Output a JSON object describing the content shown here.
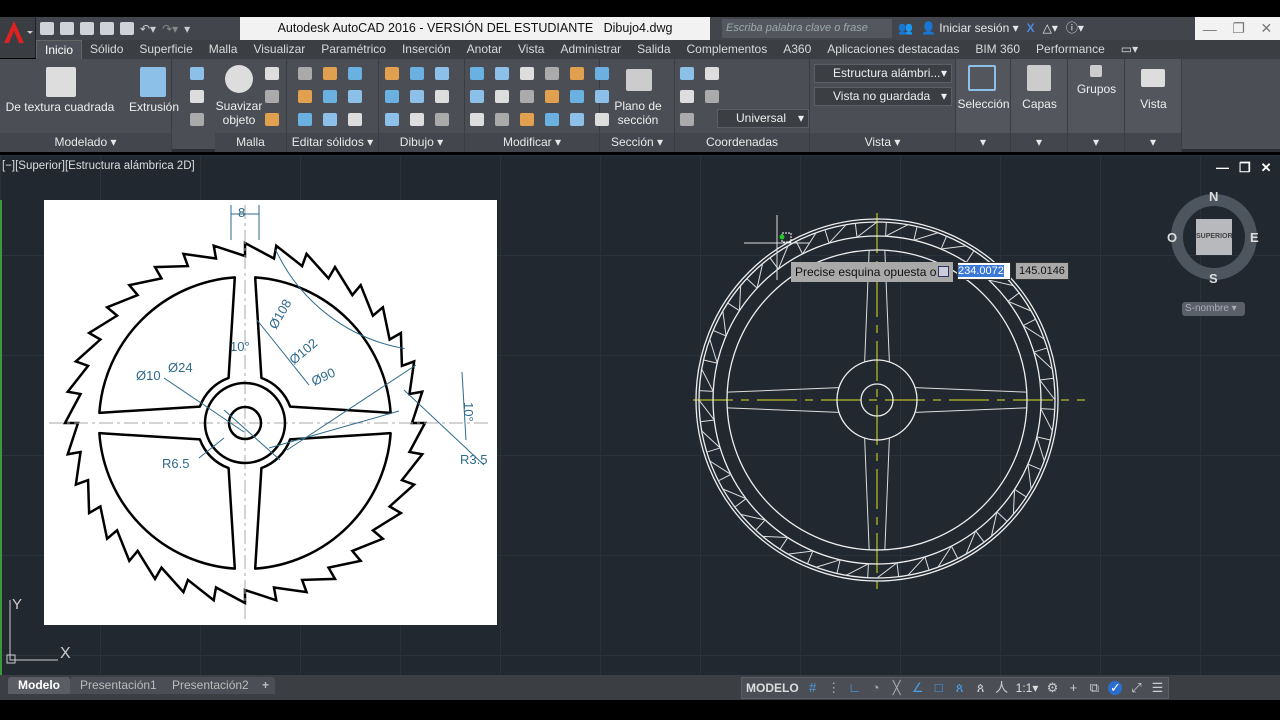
{
  "title": {
    "app": "Autodesk AutoCAD 2016 - VERSIÓN DEL ESTUDIANTE",
    "file": "Dibujo4.dwg"
  },
  "search": {
    "placeholder": "Escriba palabra clave o frase"
  },
  "signin": "Iniciar sesión",
  "tabs": [
    "Inicio",
    "Sólido",
    "Superficie",
    "Malla",
    "Visualizar",
    "Paramétrico",
    "Inserción",
    "Anotar",
    "Vista",
    "Administrar",
    "Salida",
    "Complementos",
    "A360",
    "Aplicaciones destacadas",
    "BIM 360",
    "Performance"
  ],
  "ribbon": {
    "modelado": {
      "label": "Modelado",
      "box": "De textura cuadrada",
      "extrude": "Extrusión"
    },
    "malla": {
      "label": "Malla",
      "smooth": "Suavizar objeto"
    },
    "editar": {
      "label": "Editar sólidos"
    },
    "dibujo": {
      "label": "Dibujo"
    },
    "modificar": {
      "label": "Modificar"
    },
    "seccion": {
      "label": "Sección",
      "plane": "Plano de sección"
    },
    "coordenadas": {
      "label": "Coordenadas",
      "ucs": "Universal"
    },
    "vista": {
      "label": "Vista",
      "style": "Estructura alámbri...",
      "view": "Vista no guardada"
    },
    "seleccion": "Selección",
    "capas": "Capas",
    "grupos": "Grupos",
    "vistabtn": "Vista"
  },
  "viewport": {
    "label": "[−][Superior][Estructura alámbrica 2D]"
  },
  "reference": {
    "dims": [
      "8",
      "Ø108",
      "Ø102",
      "10°",
      "Ø10",
      "Ø24",
      "Ø90",
      "10°",
      "R6.5",
      "R3.5"
    ]
  },
  "prompt": {
    "text": "Precise esquina opuesta o",
    "x": "234.0072",
    "y": "145.0146"
  },
  "viewcube": {
    "n": "N",
    "s": "S",
    "e": "E",
    "w": "O",
    "face": "SUPERIOR",
    "wcs": "S-nombre"
  },
  "ucs": {
    "x": "X",
    "y": "Y"
  },
  "layout_tabs": [
    "Modelo",
    "Presentación1",
    "Presentación2",
    "+"
  ],
  "status": {
    "mode": "MODELO",
    "scale": "1:1"
  }
}
